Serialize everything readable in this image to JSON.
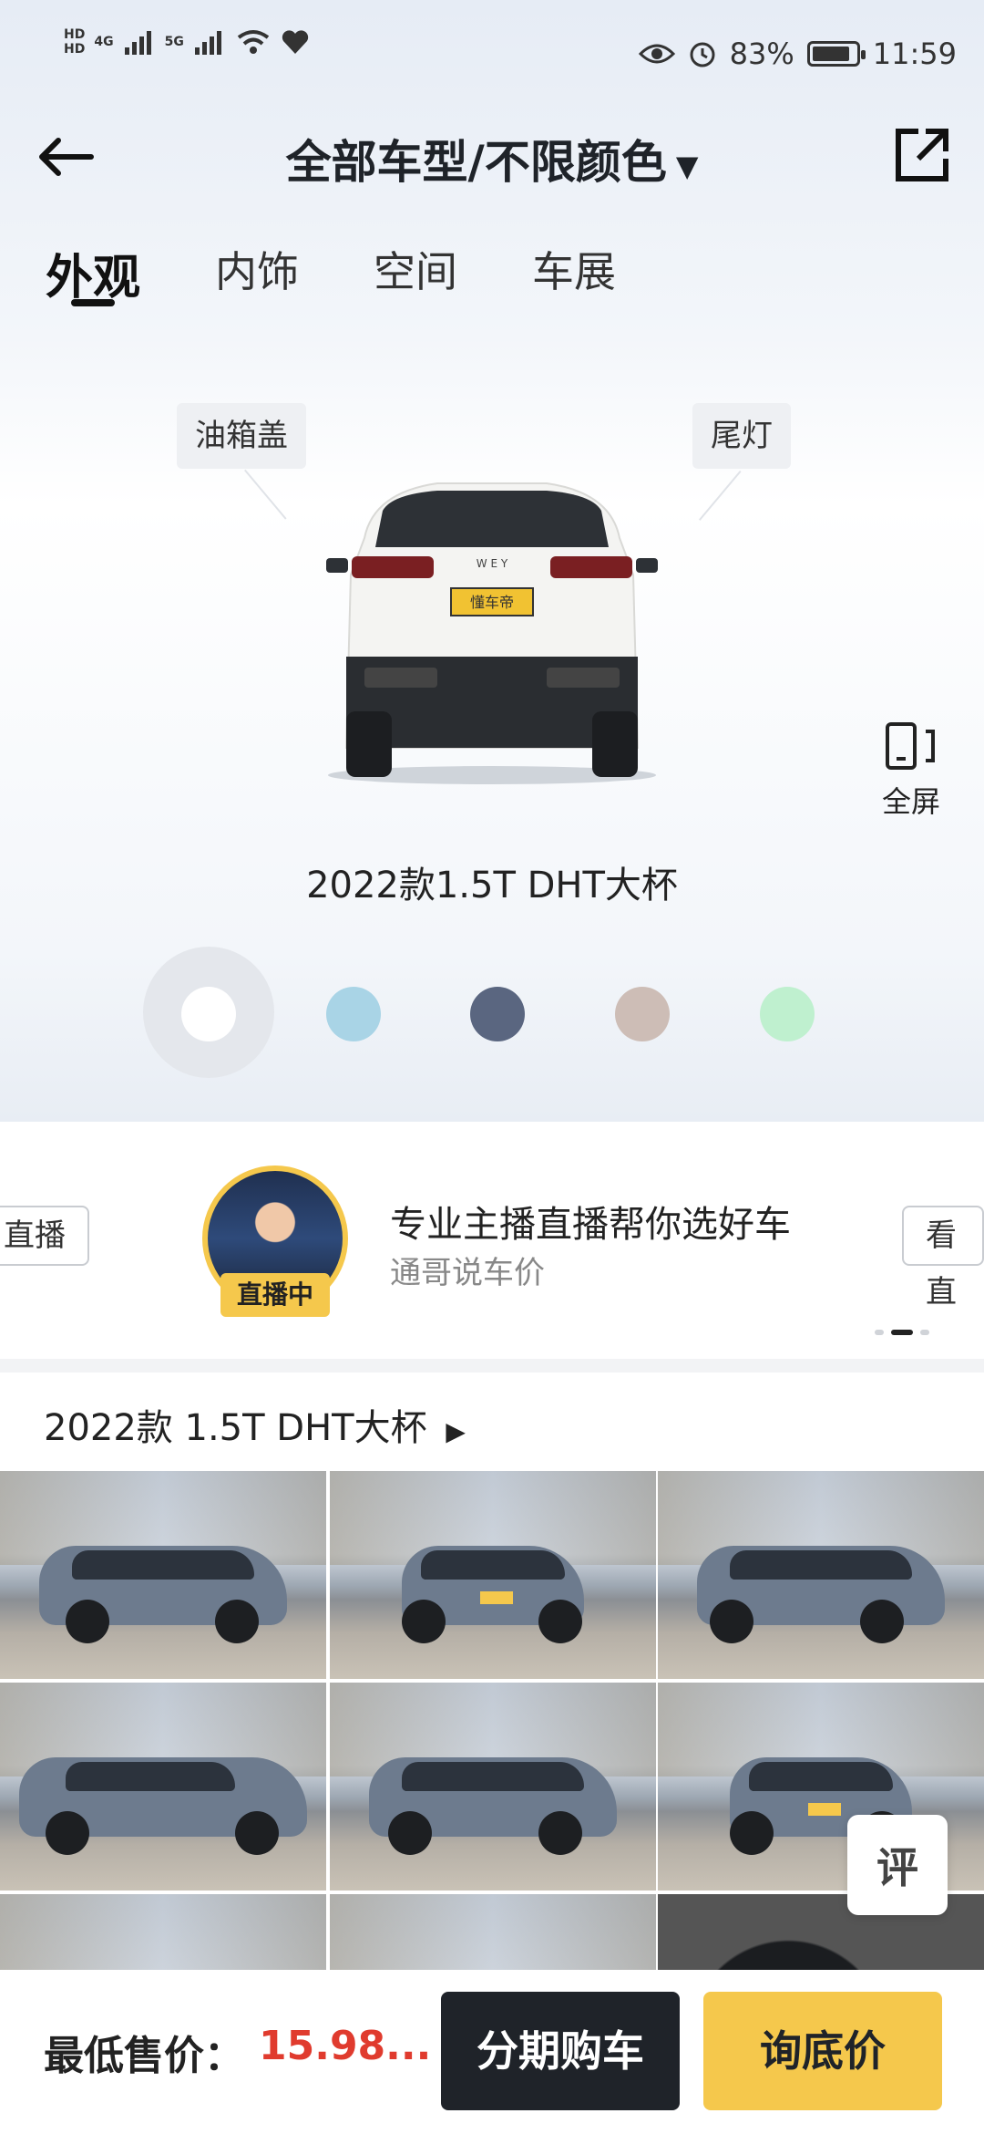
{
  "status_bar": {
    "hd1": "HD",
    "hd2": "HD",
    "net1": "4G",
    "net2": "5G",
    "battery": "83%",
    "time": "11:59"
  },
  "navbar": {
    "title": "全部车型/不限颜色",
    "caret": "▼"
  },
  "tabs": [
    {
      "label": "外观"
    },
    {
      "label": "内饰"
    },
    {
      "label": "空间"
    },
    {
      "label": "车展"
    }
  ],
  "hotspots": {
    "fuel_cap": "油箱盖",
    "tail_light": "尾灯"
  },
  "car": {
    "brand_badge": "W E Y",
    "plate": "懂车帝"
  },
  "fullscreen_label": "全屏",
  "model_caption": "2022款1.5T DHT大杯",
  "colors": {
    "swatches": [
      "#ffffff",
      "#a9d4e6",
      "#5a6680",
      "#cdbdb6",
      "#bff0cf"
    ]
  },
  "live": {
    "left_button": "直播",
    "badge": "直播中",
    "title": "专业主播直播帮你选好车",
    "subtitle": "通哥说车价",
    "right_button": "看直"
  },
  "gallery": {
    "title": "2022款 1.5T DHT大杯",
    "arrow": "▶",
    "photos": [
      {
        "label": "side-front-left"
      },
      {
        "label": "front"
      },
      {
        "label": "side-front-right"
      },
      {
        "label": "side"
      },
      {
        "label": "rear-left"
      },
      {
        "label": "rear"
      },
      {
        "label": "detail-1"
      },
      {
        "label": "detail-2"
      },
      {
        "label": "detail-3"
      }
    ]
  },
  "eval_button": "评",
  "bottom_bar": {
    "price_label": "最低售价：",
    "price_value": "15.98...",
    "installment_button": "分期购车",
    "inquiry_button": "询底价"
  }
}
